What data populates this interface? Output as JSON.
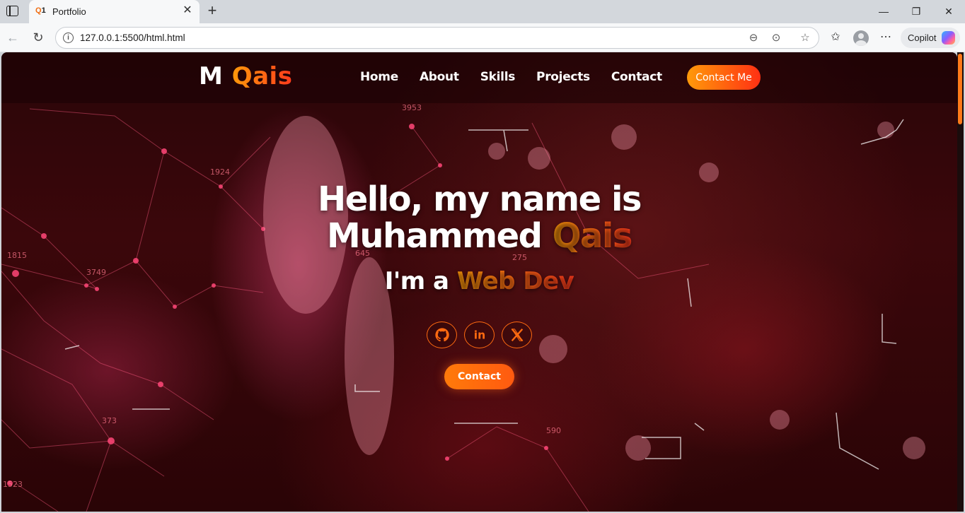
{
  "browser": {
    "tab_title": "Portfolio",
    "favicon_text": "Q",
    "favicon_sup": "1",
    "url": "127.0.0.1:5500/html.html",
    "copilot_label": "Copilot"
  },
  "site": {
    "logo_first": "M",
    "logo_accent": "Qais",
    "nav": [
      "Home",
      "About",
      "Skills",
      "Projects",
      "Contact"
    ],
    "header_cta": "Contact Me"
  },
  "hero": {
    "line1": "Hello, my name is",
    "line2_plain": "Muhammed",
    "line2_accent": "Qais",
    "role_prefix": "I'm a",
    "role_accent": "Web Dev",
    "socials": [
      "github-icon",
      "linkedin-icon",
      "x-icon"
    ],
    "cta": "Contact"
  },
  "background_labels": [
    "3953",
    "1924",
    "1815",
    "3749",
    "373",
    "1523",
    "645",
    "275",
    "590"
  ],
  "colors": {
    "accent_start": "#ff9a0a",
    "accent_end": "#ff3a1c",
    "bg_dark": "#2a0508"
  }
}
